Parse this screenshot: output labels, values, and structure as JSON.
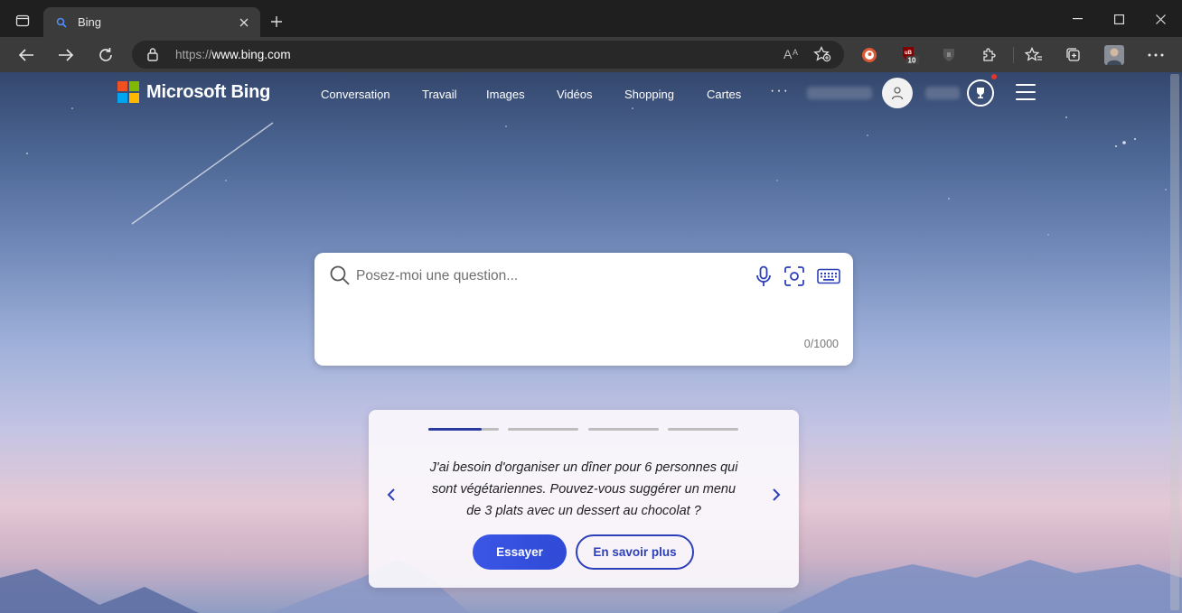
{
  "browser": {
    "tab_title": "Bing",
    "url_protocol": "https://",
    "url_host": "www.bing.com",
    "extensions": [
      "duckduckgo-icon",
      "ublock-icon",
      "shield-extension-icon",
      "extensions-icon",
      "favorites-icon",
      "collections-icon",
      "profile-avatar"
    ],
    "ublock_badge": "10"
  },
  "header": {
    "logo_text": "Microsoft Bing",
    "nav": [
      {
        "label": "Conversation"
      },
      {
        "label": "Travail"
      },
      {
        "label": "Images"
      },
      {
        "label": "Vidéos"
      },
      {
        "label": "Shopping"
      },
      {
        "label": "Cartes"
      }
    ],
    "more": "···"
  },
  "search": {
    "placeholder": "Posez-moi une question...",
    "counter": "0/1000"
  },
  "suggestion": {
    "prompt": "J'ai besoin d'organiser un dîner pour 6 personnes qui sont végétariennes. Pouvez-vous suggérer un menu de 3 plats avec un dessert au chocolat ?",
    "try_label": "Essayer",
    "learn_label": "En savoir plus",
    "carousel_progress": [
      0.75,
      0,
      0,
      0
    ]
  },
  "colors": {
    "accent": "#2d3fb8",
    "chrome_dark": "#1f1f1f",
    "chrome_toolbar": "#3b3b3b"
  }
}
